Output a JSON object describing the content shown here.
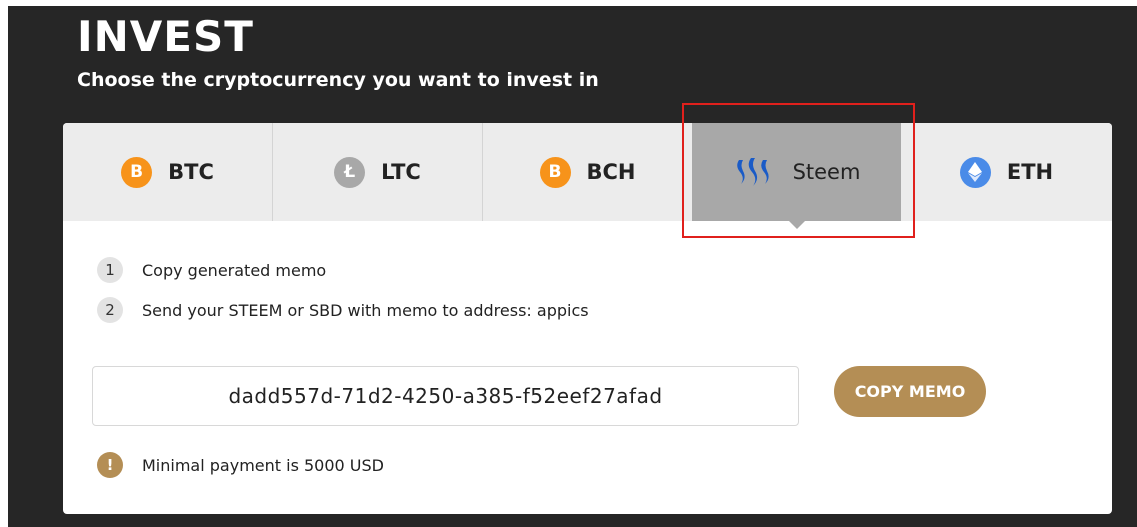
{
  "header": {
    "title": "INVEST",
    "subtitle": "Choose the cryptocurrency you want to invest in"
  },
  "tabs": [
    {
      "label": "BTC",
      "icon": "bitcoin-icon",
      "glyph": "B",
      "color": "#f7931a"
    },
    {
      "label": "LTC",
      "icon": "litecoin-icon",
      "glyph": "Ł",
      "color": "#a8a8a8"
    },
    {
      "label": "BCH",
      "icon": "bitcoin-cash-icon",
      "glyph": "B",
      "color": "#f7931a"
    },
    {
      "label": "Steem",
      "icon": "steem-icon",
      "active": true
    },
    {
      "label": "ETH",
      "icon": "ethereum-icon",
      "color": "#4a8be8"
    }
  ],
  "steps": [
    {
      "number": "1",
      "text": "Copy generated memo"
    },
    {
      "number": "2",
      "text": "Send your STEEM or SBD with memo to address: appics"
    }
  ],
  "memo": {
    "value": "dadd557d-71d2-4250-a385-f52eef27afad",
    "copy_label": "COPY MEMO"
  },
  "warning": {
    "icon": "!",
    "text": "Minimal payment is 5000 USD"
  },
  "colors": {
    "accent": "#b48e55",
    "background_dark": "#262626",
    "tab_active": "#a8a8a8",
    "highlight": "#e0201c"
  }
}
